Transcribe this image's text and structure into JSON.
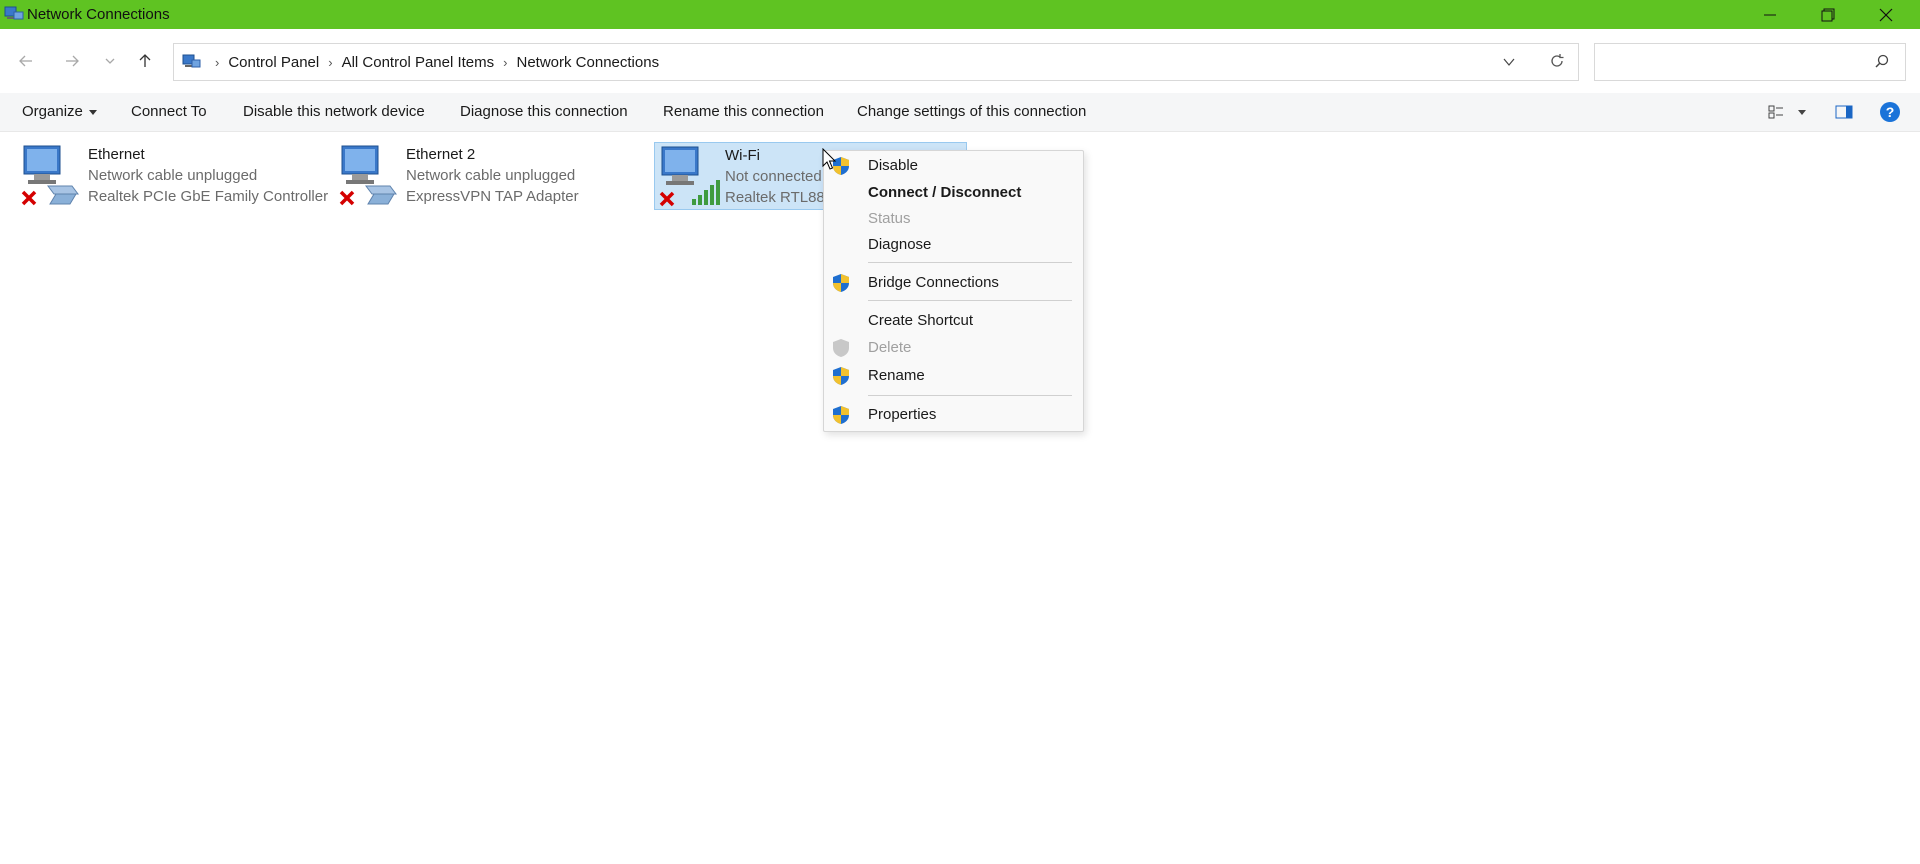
{
  "window": {
    "title": "Network Connections",
    "accent_color": "#5fc322"
  },
  "nav": {
    "back_icon": "arrow-left-icon",
    "forward_icon": "arrow-right-icon",
    "recent_icon": "chevron-down-icon",
    "up_icon": "arrow-up-icon"
  },
  "breadcrumb": {
    "items": [
      "Control Panel",
      "All Control Panel Items",
      "Network Connections"
    ]
  },
  "search": {
    "placeholder": ""
  },
  "toolbar": {
    "organize": "Organize",
    "connect_to": "Connect To",
    "disable_device": "Disable this network device",
    "diagnose": "Diagnose this connection",
    "rename": "Rename this connection",
    "change_settings": "Change settings of this connection"
  },
  "connections": [
    {
      "name": "Ethernet",
      "status": "Network cable unplugged",
      "device": "Realtek PCIe GbE Family Controller"
    },
    {
      "name": "Ethernet 2",
      "status": "Network cable unplugged",
      "device": "ExpressVPN TAP Adapter"
    },
    {
      "name": "Wi-Fi",
      "status": "Not connected",
      "device": "Realtek RTL882"
    }
  ],
  "context_menu": {
    "disable": "Disable",
    "connect_disconnect": "Connect / Disconnect",
    "status": "Status",
    "diagnose": "Diagnose",
    "bridge": "Bridge Connections",
    "create_shortcut": "Create Shortcut",
    "delete": "Delete",
    "rename": "Rename",
    "properties": "Properties"
  }
}
